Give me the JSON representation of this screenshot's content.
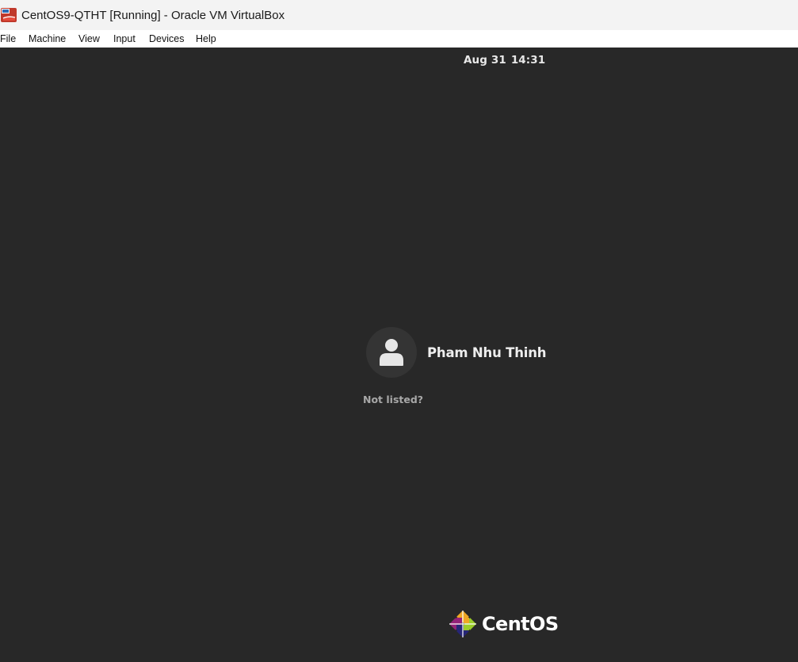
{
  "window": {
    "title": "CentOS9-QTHT [Running] - Oracle VM VirtualBox",
    "app_icon": "virtualbox-icon"
  },
  "menubar": {
    "items": [
      {
        "label": "File"
      },
      {
        "label": "Machine"
      },
      {
        "label": "View"
      },
      {
        "label": "Input"
      },
      {
        "label": "Devices"
      },
      {
        "label": "Help"
      }
    ]
  },
  "guest": {
    "clock": {
      "date": "Aug 31",
      "time": "14:31"
    },
    "user": {
      "name": "Pham Nhu Thinh",
      "avatar_icon": "user-icon"
    },
    "not_listed": "Not listed?",
    "brand": {
      "text": "CentOS",
      "logo_icon": "centos-logo-icon"
    }
  },
  "colors": {
    "background": "#282828",
    "avatar_bg": "#343434",
    "text_primary": "#eeeeee",
    "text_secondary": "#a8a8a8"
  }
}
